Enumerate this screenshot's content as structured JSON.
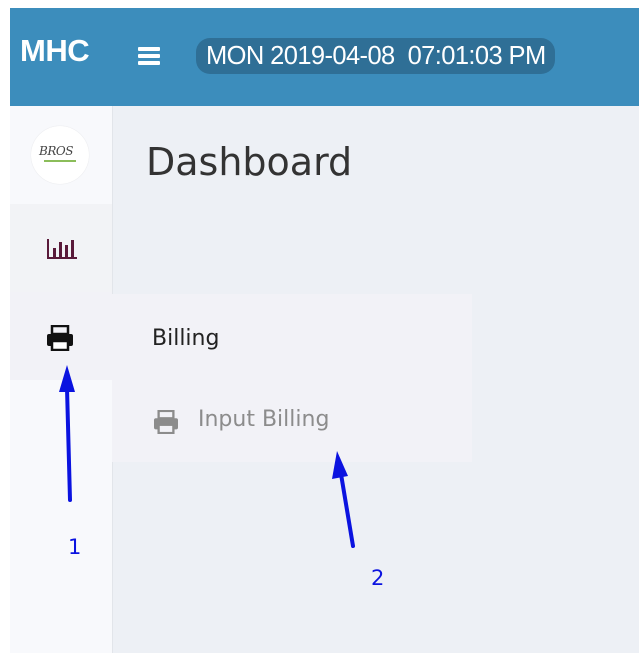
{
  "header": {
    "brand": "MHC",
    "menu_icon": "hamburger-icon",
    "clock": "MON 2019-04-08  07:01:03 PM",
    "color": "#3c8dbc"
  },
  "sidebar": {
    "logo_text": "BROS",
    "items": [
      {
        "name": "reports",
        "icon": "bar-chart-icon"
      },
      {
        "name": "billing",
        "icon": "printer-icon",
        "active": true
      }
    ]
  },
  "main": {
    "title": "Dashboard"
  },
  "flyout": {
    "header": "Billing",
    "items": [
      {
        "label": "Input Billing",
        "icon": "printer-icon"
      }
    ]
  },
  "annotations": [
    {
      "label": "1",
      "color": "#0b13e0"
    },
    {
      "label": "2",
      "color": "#0b13e0"
    }
  ]
}
